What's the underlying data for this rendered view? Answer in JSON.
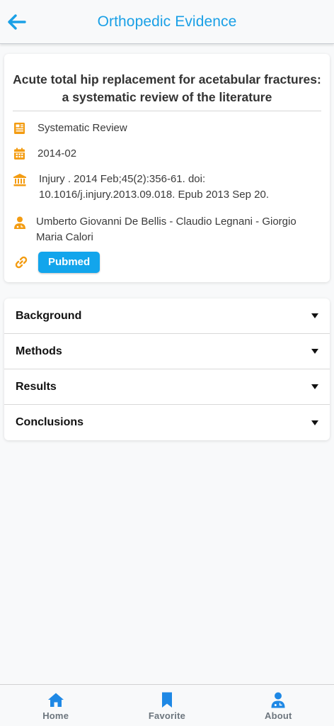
{
  "header": {
    "title": "Orthopedic Evidence",
    "back_icon": "arrow-left-icon"
  },
  "article": {
    "title": "Acute total hip replacement for acetabular fractures: a systematic review of the literature",
    "type": "Systematic Review",
    "date": "2014-02",
    "citation": "Injury . 2014 Feb;45(2):356-61. doi: 10.1016/j.injury.2013.09.018. Epub 2013 Sep 20.",
    "authors": "Umberto Giovanni De Bellis - Claudio Legnani - Giorgio Maria Calori",
    "link_label": "Pubmed",
    "icons": {
      "type": "newspaper-icon",
      "date": "calendar-icon",
      "citation": "institution-icon",
      "authors": "user-doctor-icon",
      "link": "link-icon"
    }
  },
  "sections": [
    {
      "label": "Background"
    },
    {
      "label": "Methods"
    },
    {
      "label": "Results"
    },
    {
      "label": "Conclusions"
    }
  ],
  "nav": [
    {
      "label": "Home",
      "icon": "home-icon"
    },
    {
      "label": "Favorite",
      "icon": "bookmark-icon"
    },
    {
      "label": "About",
      "icon": "user-doctor-icon"
    }
  ],
  "colors": {
    "accent": "#1aa0e6",
    "icon_orange": "#f39c12",
    "button_blue": "#12a5ec",
    "nav_blue": "#1e88e5",
    "nav_label": "#6c757d"
  }
}
